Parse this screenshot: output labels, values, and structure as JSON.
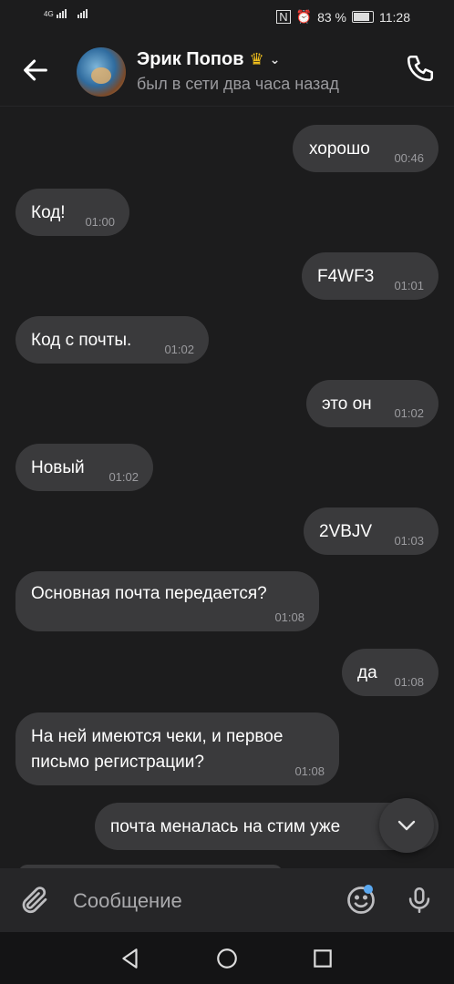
{
  "status_bar": {
    "network": "4G",
    "battery": "83 %",
    "battery_level": 0.83,
    "time": "11:28"
  },
  "header": {
    "name": "Эрик Попов",
    "subtitle": "был в сети два часа назад"
  },
  "messages": [
    {
      "text": "хорошо",
      "time": "00:46",
      "side": "out"
    },
    {
      "text": "Код!",
      "time": "01:00",
      "side": "in"
    },
    {
      "text": "F4WF3",
      "time": "01:01",
      "side": "out"
    },
    {
      "text": "Код с почты.",
      "time": "01:02",
      "side": "in"
    },
    {
      "text": "это он",
      "time": "01:02",
      "side": "out"
    },
    {
      "text": "Новый",
      "time": "01:02",
      "side": "in"
    },
    {
      "text": "2VBJV",
      "time": "01:03",
      "side": "out"
    },
    {
      "text": "Основная почта передается?",
      "time": "01:08",
      "side": "in"
    },
    {
      "text": "да",
      "time": "01:08",
      "side": "out"
    },
    {
      "text": "На ней имеются чеки, и первое письмо регистрации?",
      "time": "01:08",
      "side": "in"
    },
    {
      "text": "почта меналась на стим уже",
      "time": "",
      "side": "out"
    }
  ],
  "composer": {
    "placeholder": "Сообщение"
  },
  "icons": {
    "back": "arrow-left-icon",
    "call": "phone-icon",
    "attach": "paperclip-icon",
    "emoji": "smile-icon",
    "voice": "microphone-icon",
    "scroll_down": "chevron-down-icon"
  }
}
